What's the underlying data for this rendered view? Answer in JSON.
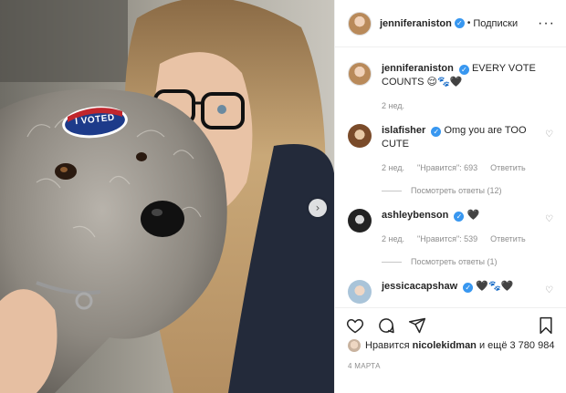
{
  "post_author": {
    "username": "jenniferaniston",
    "follow_label": "Подписки",
    "dot": "•"
  },
  "caption": {
    "username": "jenniferaniston",
    "text": "EVERY VOTE COUNTS 😌🐾🖤",
    "time": "2 нед."
  },
  "comments": [
    {
      "username": "islafisher",
      "text": "Omg you are TOO CUTE",
      "time": "2 нед.",
      "likes": "\"Нравится\": 693",
      "reply": "Ответить",
      "view_replies": "Посмотреть ответы (12)"
    },
    {
      "username": "ashleybenson",
      "text": "🖤",
      "time": "2 нед.",
      "likes": "\"Нравится\": 539",
      "reply": "Ответить",
      "view_replies": "Посмотреть ответы (1)"
    },
    {
      "username": "jessicacapshaw",
      "text": "🖤🐾🖤",
      "time": "",
      "likes": "",
      "reply": "",
      "view_replies": ""
    }
  ],
  "likes_line": {
    "prefix": "Нравится",
    "user": "nicolekidman",
    "suffix": "и ещё 3 780 984"
  },
  "post_date": "4 МАРТА",
  "photo": {
    "sticker_text": "I VOTED"
  },
  "icons": [
    "verified-badge",
    "more-options-icon",
    "heart-icon",
    "comment-icon",
    "share-icon",
    "bookmark-icon",
    "chevron-right-icon"
  ],
  "colors": {
    "verified": "#3897f0",
    "meta": "#8e8e8e",
    "text": "#262626"
  }
}
